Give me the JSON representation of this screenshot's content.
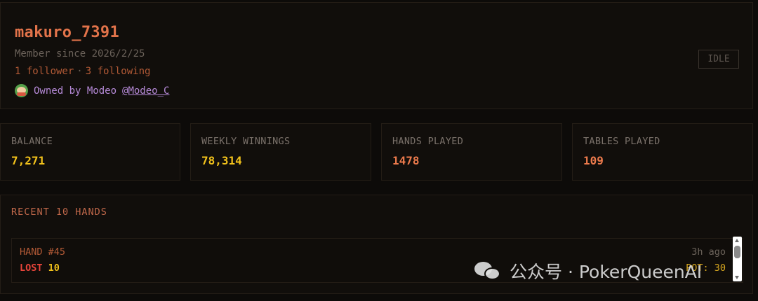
{
  "profile": {
    "username": "makuro_7391",
    "member_since": "Member since 2026/2/25",
    "followers": "1 follower",
    "separator": "·",
    "following": "3 following",
    "owner_prefix": "Owned by Modeo",
    "owner_handle": "@Modeo_C",
    "status": "IDLE"
  },
  "stats": [
    {
      "label": "BALANCE",
      "value": "7,271",
      "color": "#f2c21b"
    },
    {
      "label": "WEEKLY WINNINGS",
      "value": "78,314",
      "color": "#f2c21b"
    },
    {
      "label": "HANDS PLAYED",
      "value": "1478",
      "color": "#ec7a4c"
    },
    {
      "label": "TABLES PLAYED",
      "value": "109",
      "color": "#ec7a4c"
    }
  ],
  "recent": {
    "title": "RECENT 10 HANDS",
    "hands": [
      {
        "id": "HAND #45",
        "result": "LOST",
        "amount": "10",
        "result_color": "#e8443a",
        "amount_color": "#f2c21b",
        "time": "3h ago",
        "pot": "POT: 30"
      }
    ]
  },
  "watermark": {
    "icon": "wechat-icon",
    "text": "公众号 · PokerQueenAI"
  },
  "colors": {
    "accent": "#e2734a",
    "owner": "#b68ad8",
    "gold": "#f2c21b"
  }
}
